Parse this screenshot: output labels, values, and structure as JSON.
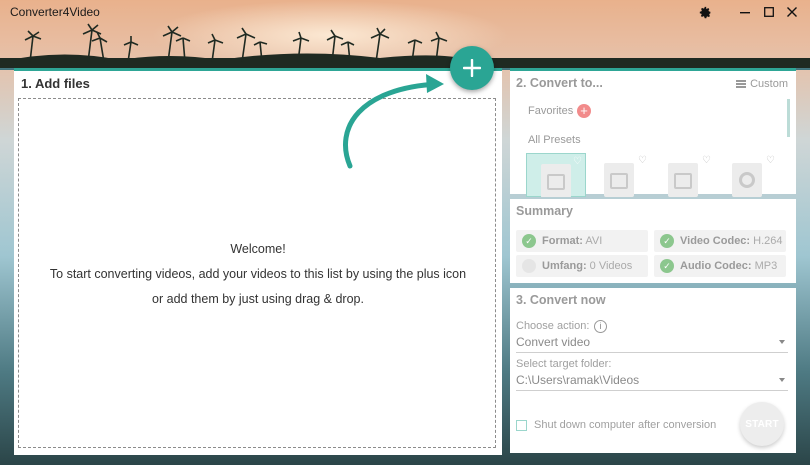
{
  "app": {
    "title": "Converter4Video",
    "accent_color": "#2aa594"
  },
  "window_controls": {
    "settings_icon": "gear-icon",
    "minimize_icon": "minimize-icon",
    "maximize_icon": "maximize-icon",
    "close_icon": "close-icon"
  },
  "add_files": {
    "heading": "1. Add files",
    "add_button_icon": "plus-icon",
    "welcome_title": "Welcome!",
    "welcome_line1": "To start converting videos, add your videos to this list by using the plus icon",
    "welcome_line2": "or add them by just using drag & drop."
  },
  "convert_to": {
    "heading": "2. Convert to...",
    "custom_label": "Custom",
    "favorites_label": "Favorites",
    "all_presets_label": "All Presets",
    "presets": [
      {
        "icon": "film-icon",
        "selected": true
      },
      {
        "icon": "film-icon",
        "selected": false
      },
      {
        "icon": "film-icon",
        "selected": false
      },
      {
        "icon": "disc-icon",
        "selected": false
      }
    ]
  },
  "summary": {
    "heading": "Summary",
    "items": [
      {
        "label": "Format:",
        "value": "AVI",
        "checked": true
      },
      {
        "label": "Video Codec:",
        "value": "H.264",
        "checked": true
      },
      {
        "label": "Umfang:",
        "value": "0 Videos",
        "checked": false
      },
      {
        "label": "Audio Codec:",
        "value": "MP3",
        "checked": true
      }
    ]
  },
  "convert_now": {
    "heading": "3. Convert now",
    "choose_action_label": "Choose action:",
    "action_value": "Convert video",
    "target_folder_label": "Select target folder:",
    "target_folder_value": "C:\\Users\\ramak\\Videos",
    "shutdown_label": "Shut down computer after conversion",
    "start_label": "START"
  }
}
